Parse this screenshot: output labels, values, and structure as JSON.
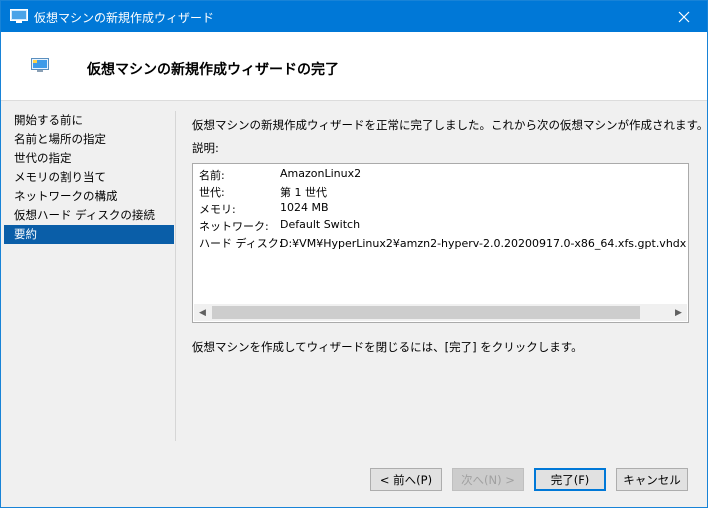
{
  "window": {
    "title": "仮想マシンの新規作成ウィザード"
  },
  "header": {
    "title": "仮想マシンの新規作成ウィザードの完了"
  },
  "nav": {
    "items": [
      {
        "label": "開始する前に"
      },
      {
        "label": "名前と場所の指定"
      },
      {
        "label": "世代の指定"
      },
      {
        "label": "メモリの割り当て"
      },
      {
        "label": "ネットワークの構成"
      },
      {
        "label": "仮想ハード ディスクの接続"
      },
      {
        "label": "要約"
      }
    ],
    "selected_index": 6
  },
  "content": {
    "intro": "仮想マシンの新規作成ウィザードを正常に完了しました。これから次の仮想マシンが作成されます。",
    "desc_label": "説明:",
    "summary": [
      {
        "key": "名前:",
        "value": "AmazonLinux2"
      },
      {
        "key": "世代:",
        "value": "第 1 世代"
      },
      {
        "key": "メモリ:",
        "value": "1024 MB"
      },
      {
        "key": "ネットワーク:",
        "value": "Default Switch"
      },
      {
        "key": "ハード ディスク:",
        "value": "D:¥VM¥HyperLinux2¥amzn2-hyperv-2.0.20200917.0-x86_64.xfs.gpt.vhdx (VHDX、容"
      }
    ],
    "finish_note": "仮想マシンを作成してウィザードを閉じるには、[完了] をクリックします。"
  },
  "buttons": {
    "prev": "< 前へ(P)",
    "next": "次へ(N) >",
    "finish": "完了(F)",
    "cancel": "キャンセル"
  },
  "colors": {
    "titlebar": "#0078d7",
    "selected_nav": "#0a5ea8",
    "default_button_border": "#0078d7"
  }
}
